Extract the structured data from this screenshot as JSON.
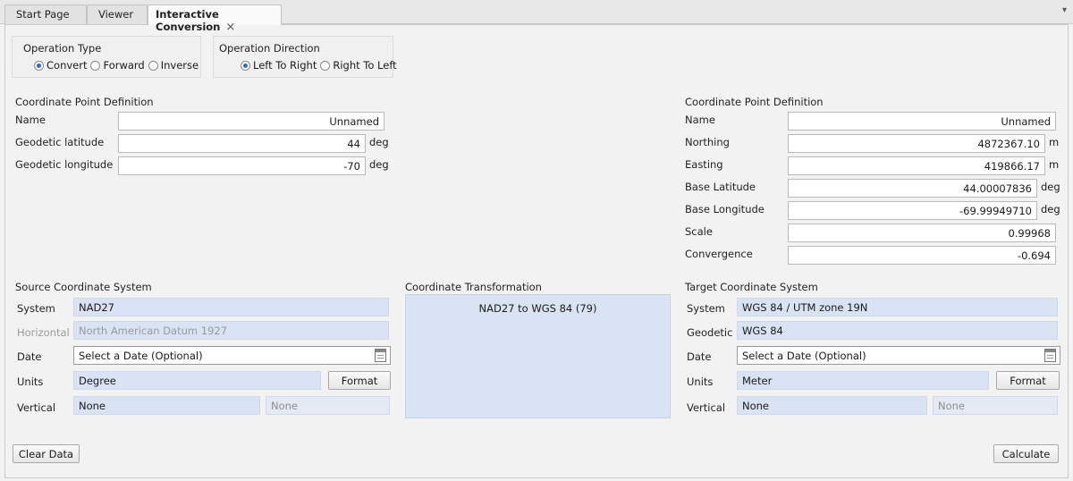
{
  "tabs": [
    {
      "label": "Start Page"
    },
    {
      "label": "Viewer"
    },
    {
      "label": "Interactive Conversion",
      "close": "×"
    }
  ],
  "tab_menu_glyph": "▾",
  "operation_type": {
    "title": "Operation Type",
    "options": [
      "Convert",
      "Forward",
      "Inverse"
    ],
    "selected": "Convert"
  },
  "operation_direction": {
    "title": "Operation Direction",
    "options": [
      "Left To Right",
      "Right To Left"
    ],
    "selected": "Left To Right"
  },
  "source_point": {
    "title": "Coordinate Point Definition",
    "fields": [
      {
        "label": "Name",
        "value": "Unnamed",
        "unit": ""
      },
      {
        "label": "Geodetic latitude",
        "value": "44",
        "unit": "deg"
      },
      {
        "label": "Geodetic longitude",
        "value": "-70",
        "unit": "deg"
      }
    ]
  },
  "target_point": {
    "title": "Coordinate Point Definition",
    "fields": [
      {
        "label": "Name",
        "value": "Unnamed",
        "unit": ""
      },
      {
        "label": "Northing",
        "value": "4872367.10",
        "unit": "m"
      },
      {
        "label": "Easting",
        "value": "419866.17",
        "unit": "m"
      },
      {
        "label": "Base Latitude",
        "value": "44.00007836",
        "unit": "deg"
      },
      {
        "label": "Base Longitude",
        "value": "-69.99949710",
        "unit": "deg"
      },
      {
        "label": "Scale",
        "value": "0.99968",
        "unit": ""
      },
      {
        "label": "Convergence",
        "value": "-0.694",
        "unit": ""
      }
    ]
  },
  "source_cs": {
    "title": "Source Coordinate System",
    "system_label": "System",
    "system": "NAD27",
    "horizontal_label": "Horizontal",
    "horizontal": "North American Datum 1927",
    "date_label": "Date",
    "date_placeholder": "Select a Date (Optional)",
    "units_label": "Units",
    "units": "Degree",
    "format_label": "Format",
    "vertical_label": "Vertical",
    "vertical": "None",
    "vertical2": "None"
  },
  "transformation": {
    "title": "Coordinate Transformation",
    "value": "NAD27 to WGS 84 (79)"
  },
  "target_cs": {
    "title": "Target Coordinate System",
    "system_label": "System",
    "system": "WGS 84 / UTM zone 19N",
    "geodetic_label": "Geodetic",
    "geodetic": "WGS 84",
    "date_label": "Date",
    "date_placeholder": "Select a Date (Optional)",
    "units_label": "Units",
    "units": "Meter",
    "format_label": "Format",
    "vertical_label": "Vertical",
    "vertical": "None",
    "vertical2": "None"
  },
  "footer": {
    "clear_label": "Clear Data",
    "calculate_label": "Calculate"
  },
  "colors": {
    "selection_fill": "#d9e3f3",
    "radio_accent": "#2b6bc2"
  }
}
